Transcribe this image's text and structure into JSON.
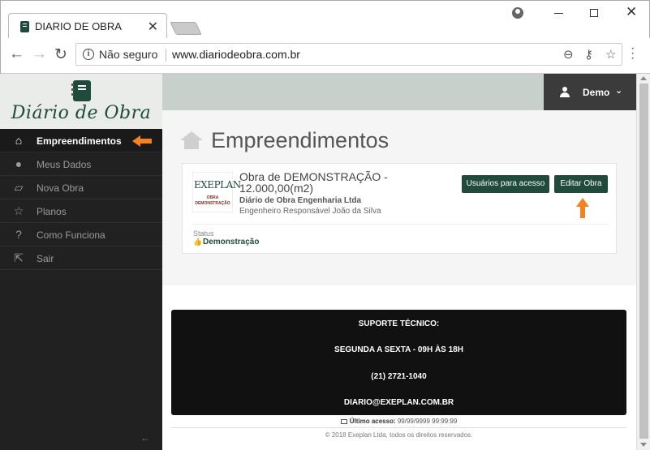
{
  "browser": {
    "tab_title": "DIARIO DE OBRA",
    "tab_close": "✕",
    "security_label": "Não seguro",
    "url": "www.diariodeobra.com.br",
    "window_close": "✕"
  },
  "sidebar": {
    "logo_text": "Diário de Obra",
    "items": [
      {
        "label": "Empreendimentos",
        "icon": "home-icon",
        "glyph": "⌂",
        "active": true
      },
      {
        "label": "Meus Dados",
        "icon": "user-icon",
        "glyph": "●",
        "active": false
      },
      {
        "label": "Nova Obra",
        "icon": "map-icon",
        "glyph": "▱",
        "active": false
      },
      {
        "label": "Planos",
        "icon": "star-icon",
        "glyph": "☆",
        "active": false
      },
      {
        "label": "Como Funciona",
        "icon": "question-icon",
        "glyph": "?",
        "active": false
      },
      {
        "label": "Sair",
        "icon": "logout-icon",
        "glyph": "⇱",
        "active": false
      }
    ],
    "collapse_glyph": "←"
  },
  "header": {
    "user_name": "Demo",
    "chevron": "⌄"
  },
  "main": {
    "title": "Empreendimentos",
    "project": {
      "logo_name": "EXEPLAN",
      "logo_sub": "OBRA DEMONSTRAÇÃO",
      "title": "Obra de DEMONSTRAÇÃO - 12.000,00(m2)",
      "company": "Diário de Obra Engenharia Ltda",
      "engineer": "Engenheiro Responsável João da Silva",
      "status_label": "Status",
      "status_value": "Demonstração",
      "users_button": "Usuários para acesso",
      "edit_button": "Editar Obra"
    }
  },
  "footer": {
    "support_title": "SUPORTE TÉCNICO:",
    "hours": "SEGUNDA A SEXTA - 09H ÀS 18H",
    "phone": "(21) 2721-1040",
    "email": "DIARIO@EXEPLAN.COM.BR",
    "last_access_label": "Último acesso:",
    "last_access_value": "99/99/9999 99:99:99",
    "copyright": "© 2018 Exeplan Ltda, todos os direitos reservados."
  },
  "colors": {
    "brand": "#1f4a3c",
    "accent_arrow": "#f58220",
    "sidebar_bg": "#212121"
  }
}
